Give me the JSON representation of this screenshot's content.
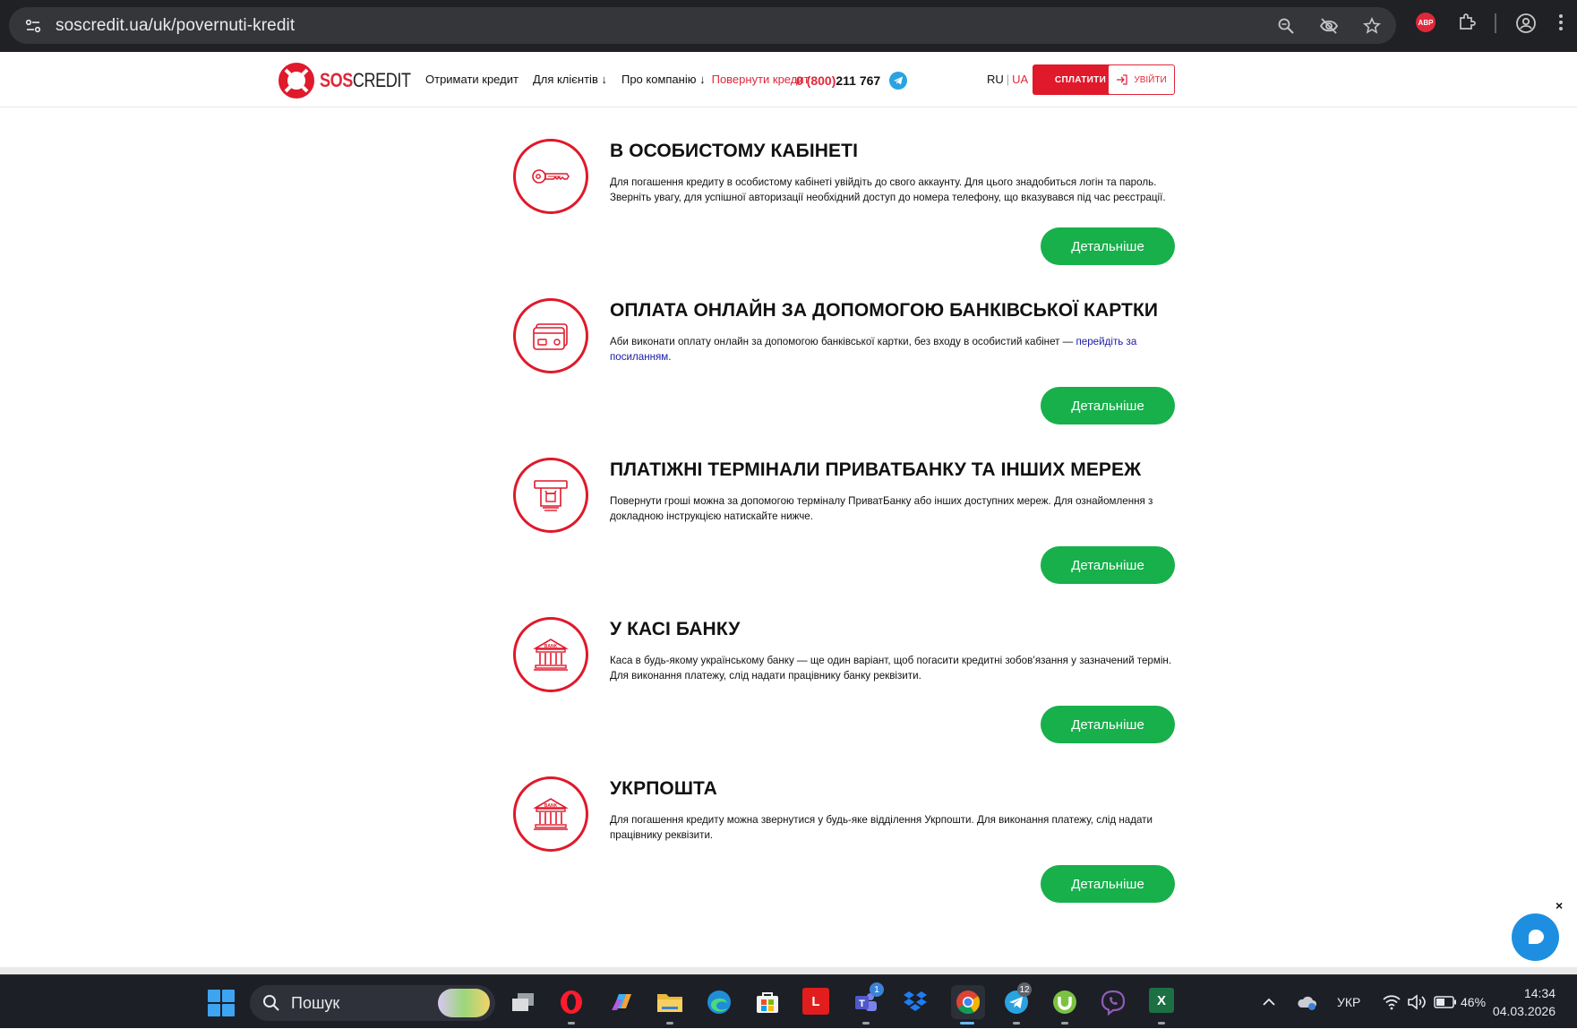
{
  "browser": {
    "url": "soscredit.ua/uk/povernuti-kredit"
  },
  "header": {
    "logo_sos": "SOS",
    "logo_credit": "CREDIT",
    "nav": [
      {
        "label": "Отримати кредит",
        "active": false
      },
      {
        "label": "Для клієнтів ↓",
        "active": false
      },
      {
        "label": "Про компанію ↓",
        "active": false
      },
      {
        "label": "Повернути кредит",
        "active": true
      }
    ],
    "phone_prefix": "0 (800)",
    "phone_number": " 211 767",
    "lang_ru": "RU",
    "lang_sep": "|",
    "lang_ua": "UA",
    "pay_label": "СПЛАТИТИ",
    "login_label": "УВІЙТИ"
  },
  "sections": [
    {
      "title": "В ОСОБИСТОМУ КАБІНЕТІ",
      "text": "Для погашення кредиту в особистому кабінеті увійдіть до свого аккаунту. Для цього знадобиться логін та пароль. Зверніть увагу, для успішної авторизації необхідний доступ до номера телефону, що вказувався під час реєстрації.",
      "link": "",
      "text_after": "",
      "button": "Детальніше",
      "icon": "key-icon"
    },
    {
      "title": "ОПЛАТА ОНЛАЙН ЗА ДОПОМОГОЮ БАНКІВСЬКОЇ КАРТКИ",
      "text": "Аби виконати оплату онлайн за допомогою банківської картки, без входу в особистий кабінет — ",
      "link": "перейдіть за посиланням",
      "text_after": ".",
      "button": "Детальніше",
      "icon": "bank-card-icon"
    },
    {
      "title": "ПЛАТІЖНІ ТЕРМІНАЛИ ПРИВАТБАНКУ ТА ІНШИХ МЕРЕЖ",
      "text": "Повернути гроші можна за допомогою терміналу ПриватБанку або інших доступних мереж. Для ознайомлення з докладною інструкцією натискайте нижче.",
      "link": "",
      "text_after": "",
      "button": "Детальніше",
      "icon": "terminal-icon"
    },
    {
      "title": "У КАСІ БАНКУ",
      "text": "Каса в будь-якому українському банку — ще один варіант, щоб погасити кредитні зобов’язання у зазначений термін. Для виконання платежу, слід надати працівнику банку реквізити.",
      "link": "",
      "text_after": "",
      "button": "Детальніше",
      "icon": "bank-building-icon"
    },
    {
      "title": "УКРПОШТА",
      "text": "Для погашення кредиту можна звернутися у будь-яке відділення Укрпошти. Для виконання платежу, слід надати працівнику реквізити.",
      "link": "",
      "text_after": "",
      "button": "Детальніше",
      "icon": "bank-building-icon"
    }
  ],
  "chat": {
    "close_label": "×"
  },
  "taskbar": {
    "search_placeholder": "Пошук",
    "teams_badge": "1",
    "telegram_badge": "12",
    "lang": "УКР",
    "battery": "46%",
    "time": "14:34",
    "date": "04.03.2026",
    "lingvo_letter": "L",
    "excel_letter": "X"
  },
  "colors": {
    "brand_red": "#e0192b",
    "green_button": "#17b04b",
    "link_blue": "#1a1aa6"
  }
}
